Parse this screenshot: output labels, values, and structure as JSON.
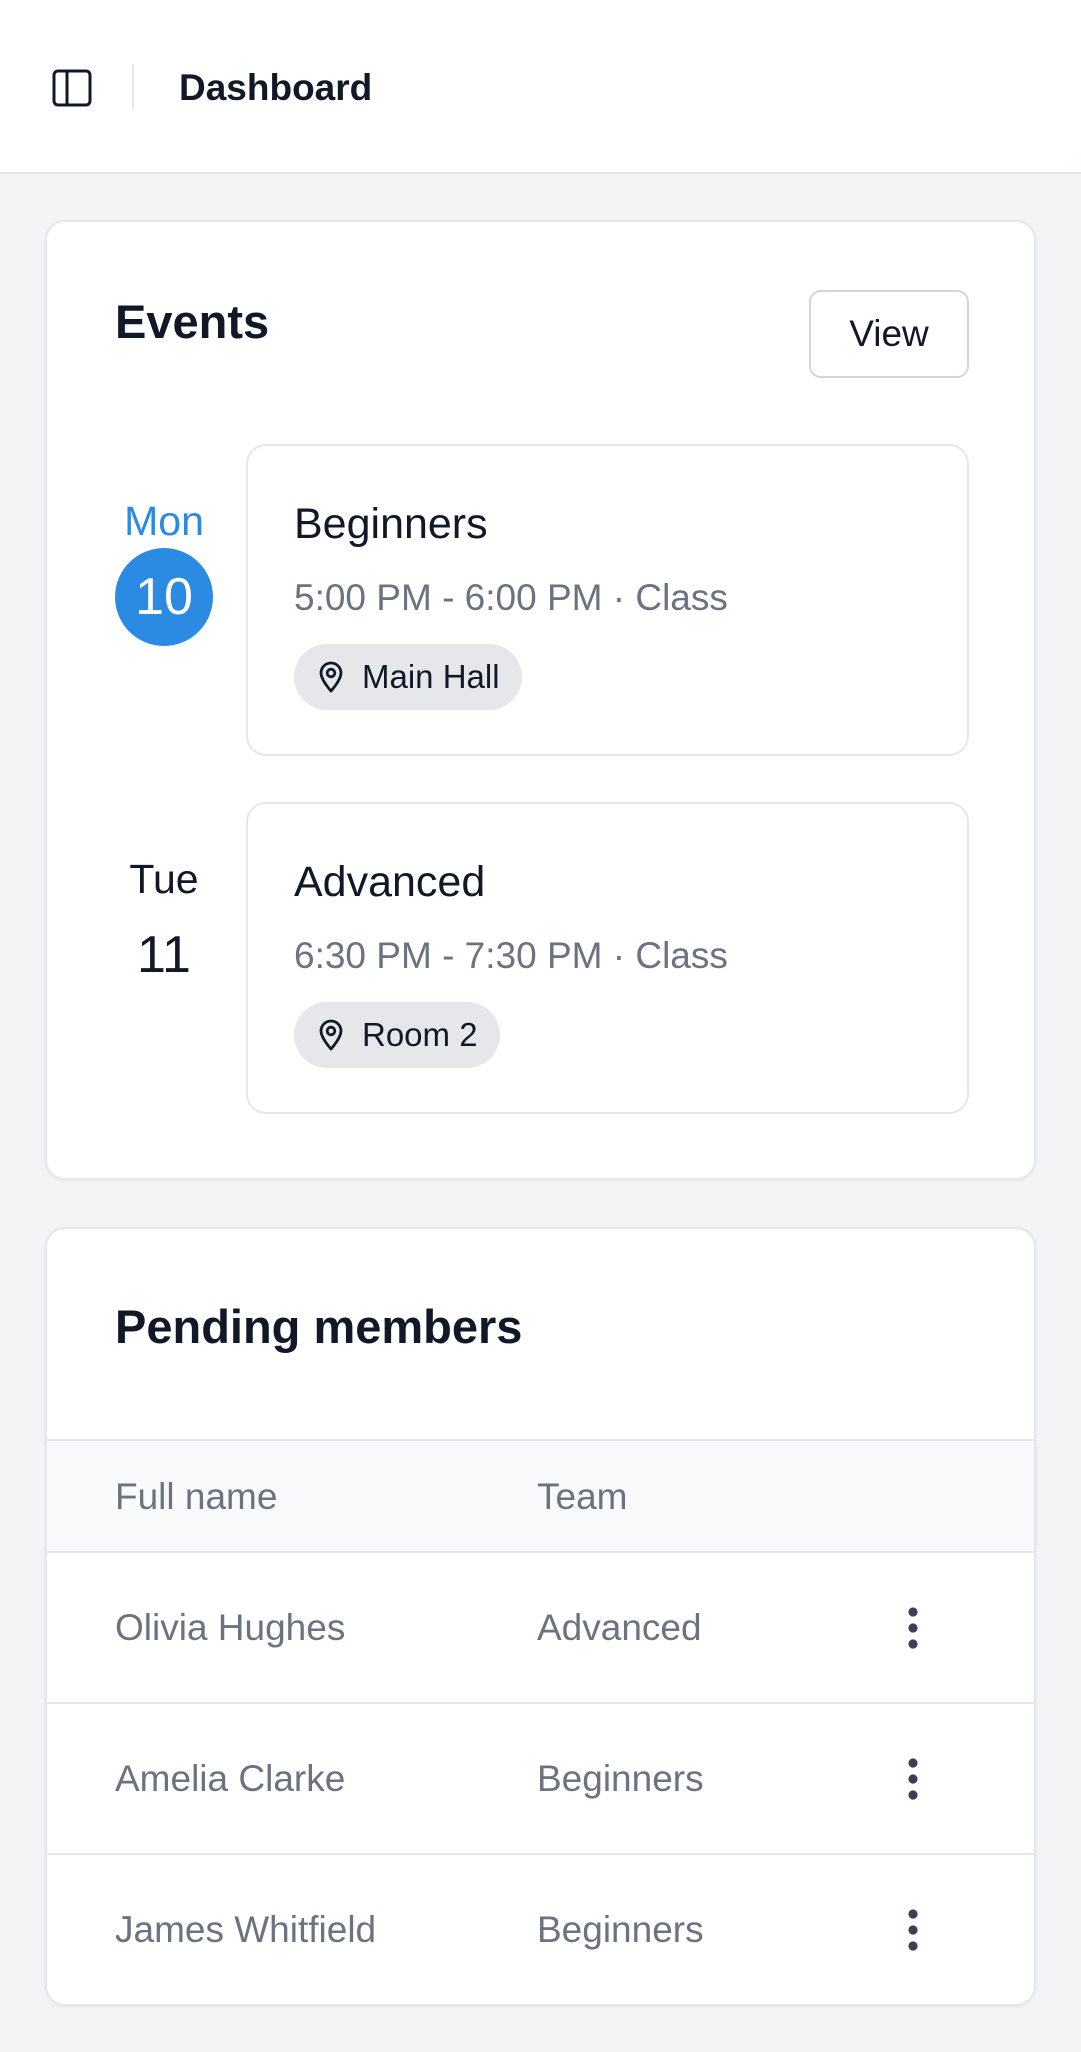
{
  "header": {
    "title": "Dashboard",
    "toggle_icon": "sidebar-toggle-icon"
  },
  "events": {
    "title": "Events",
    "view_label": "View",
    "items": [
      {
        "day_name": "Mon",
        "day_num": "10",
        "is_today": true,
        "title": "Beginners",
        "time": "5:00 PM - 6:00 PM · Class",
        "location": "Main Hall"
      },
      {
        "day_name": "Tue",
        "day_num": "11",
        "is_today": false,
        "title": "Advanced",
        "time": "6:30 PM - 7:30 PM · Class",
        "location": "Room 2"
      }
    ]
  },
  "members": {
    "title": "Pending members",
    "columns": [
      "Full name",
      "Team"
    ],
    "rows": [
      {
        "name": "Olivia Hughes",
        "team": "Advanced"
      },
      {
        "name": "Amelia Clarke",
        "team": "Beginners"
      },
      {
        "name": "James Whitfield",
        "team": "Beginners"
      }
    ]
  },
  "colors": {
    "accent": "#2b8ae2",
    "background": "#f3f4f6",
    "muted_text": "#6b7280",
    "border": "#e5e7eb"
  }
}
